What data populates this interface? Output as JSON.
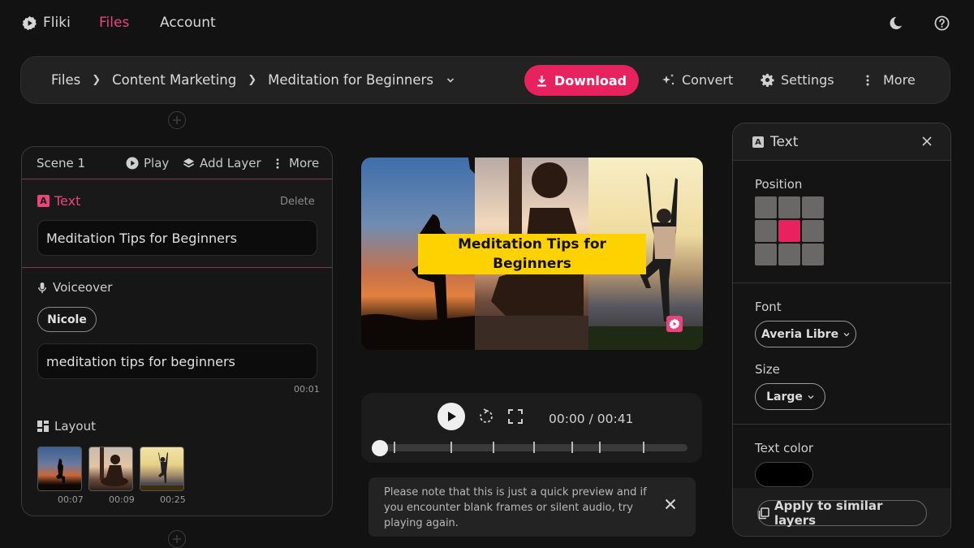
{
  "nav": {
    "brand": "Fliki",
    "items": [
      {
        "label": "Files",
        "active": true
      },
      {
        "label": "Account",
        "active": false
      }
    ],
    "icons": [
      "moon-icon",
      "help-icon"
    ]
  },
  "toolbar": {
    "breadcrumb": [
      "Files",
      "Content Marketing",
      "Meditation for Beginners"
    ],
    "download_label": "Download",
    "convert_label": "Convert",
    "settings_label": "Settings",
    "more_label": "More"
  },
  "scene": {
    "title": "Scene 1",
    "play_label": "Play",
    "add_layer_label": "Add Layer",
    "more_label": "More",
    "text_layer": {
      "label": "Text",
      "delete_label": "Delete",
      "value": "Meditation Tips for Beginners"
    },
    "voiceover": {
      "label": "Voiceover",
      "voice": "Nicole",
      "text": "meditation tips for beginners",
      "duration": "00:01"
    },
    "layout": {
      "label": "Layout",
      "thumbnails": [
        {
          "time": "00:07"
        },
        {
          "time": "00:09"
        },
        {
          "time": "00:25"
        }
      ]
    }
  },
  "preview": {
    "overlay_text": "Meditation Tips for Beginners"
  },
  "player": {
    "current_time": "00:00",
    "separator": " / ",
    "total_time": "00:41",
    "time_display": "00:00 / 00:41",
    "progress": 0
  },
  "note": {
    "text": "Please note that this is just a quick preview and if you encounter blank frames or silent audio, try playing again."
  },
  "text_panel": {
    "title": "Text",
    "position_label": "Position",
    "position_selected": "middle-center",
    "font_label": "Font",
    "font_value": "Averia Libre",
    "size_label": "Size",
    "size_value": "Large",
    "text_color_label": "Text color",
    "text_color": "#000000",
    "apply_label": "Apply to similar layers"
  },
  "colors": {
    "accent": "#e8215f",
    "accent_text": "#e8457a",
    "banner": "#fdd200"
  }
}
